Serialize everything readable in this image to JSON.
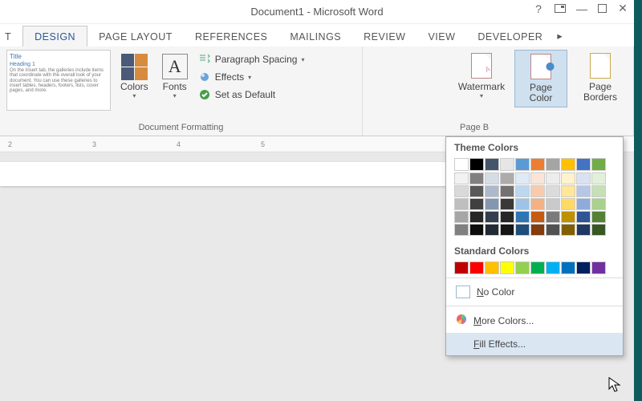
{
  "title": "Document1 - Microsoft Word",
  "tabs": {
    "t0": "T",
    "t1": "DESIGN",
    "t2": "PAGE LAYOUT",
    "t3": "REFERENCES",
    "t4": "MAILINGS",
    "t5": "REVIEW",
    "t6": "VIEW",
    "t7": "DEVELOPER"
  },
  "theme": {
    "title": "Title",
    "heading": "Heading 1",
    "body": "On the Insert tab, the galleries include items that coordinate with the overall look of your document. You can use these galleries to insert tables, headers, footers, lists, cover pages, and more."
  },
  "btn": {
    "colors": "Colors",
    "fonts": "Fonts",
    "pspacing": "Paragraph Spacing",
    "effects": "Effects",
    "setdef": "Set as Default",
    "watermark": "Watermark",
    "pagecolor": "Page\nColor",
    "borders": "Page\nBorders"
  },
  "grp": {
    "fmt": "Document Formatting",
    "bg": "Page B"
  },
  "ruler": {
    "r2": "2",
    "r3": "3",
    "r4": "4",
    "r5": "5"
  },
  "dd": {
    "theme": "Theme Colors",
    "std": "Standard Colors",
    "nocolor": "No Color",
    "more": "More Colors...",
    "fill": "Fill Effects..."
  },
  "theme_colors": [
    "#ffffff",
    "#000000",
    "#44546a",
    "#e7e6e6",
    "#5b9bd5",
    "#ed7d31",
    "#a5a5a5",
    "#ffc000",
    "#4472c4",
    "#70ad47"
  ],
  "shades": [
    [
      "#f2f2f2",
      "#d9d9d9",
      "#bfbfbf",
      "#a6a6a6",
      "#808080"
    ],
    [
      "#808080",
      "#595959",
      "#404040",
      "#262626",
      "#0d0d0d"
    ],
    [
      "#d6dce5",
      "#adb9ca",
      "#8497b0",
      "#333f50",
      "#222a35"
    ],
    [
      "#aeabab",
      "#767171",
      "#3b3838",
      "#262626",
      "#171616"
    ],
    [
      "#deebf7",
      "#bdd7ee",
      "#9dc3e6",
      "#2e75b6",
      "#1f4e79"
    ],
    [
      "#fbe5d6",
      "#f8cbad",
      "#f4b183",
      "#c55a11",
      "#843c0c"
    ],
    [
      "#ededed",
      "#dbdbdb",
      "#c9c9c9",
      "#7b7b7b",
      "#525252"
    ],
    [
      "#fff2cc",
      "#ffe699",
      "#ffd966",
      "#bf9000",
      "#806000"
    ],
    [
      "#d9e2f3",
      "#b4c7e7",
      "#8faadc",
      "#2f5597",
      "#203864"
    ],
    [
      "#e2f0d9",
      "#c5e0b4",
      "#a9d18e",
      "#548235",
      "#385723"
    ]
  ],
  "std_colors": [
    "#c00000",
    "#ff0000",
    "#ffc000",
    "#ffff00",
    "#92d050",
    "#00b050",
    "#00b0f0",
    "#0070c0",
    "#002060",
    "#7030a0"
  ]
}
